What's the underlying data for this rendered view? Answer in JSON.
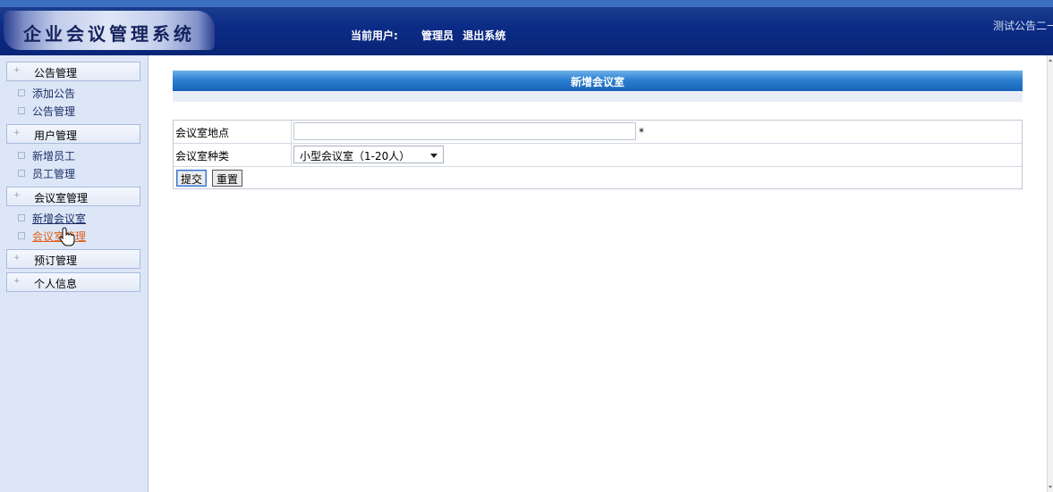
{
  "header": {
    "app_title": "企业会议管理系统",
    "current_user_label": "当前用户:",
    "current_user": "管理员",
    "logout": "退出系统",
    "notice": "测试公告二一"
  },
  "sidebar": {
    "groups": [
      {
        "label": "公告管理",
        "items": [
          "添加公告",
          "公告管理"
        ]
      },
      {
        "label": "用户管理",
        "items": [
          "新增员工",
          "员工管理"
        ]
      },
      {
        "label": "会议室管理",
        "items": [
          "新增会议室",
          "会议室管理"
        ]
      },
      {
        "label": "预订管理",
        "items": []
      },
      {
        "label": "个人信息",
        "items": []
      }
    ]
  },
  "main": {
    "title": "新增会议室",
    "form": {
      "location_label": "会议室地点",
      "location_value": "",
      "required_mark": "*",
      "type_label": "会议室种类",
      "type_selected": "小型会议室（1-20人）",
      "submit": "提交",
      "reset": "重置"
    }
  },
  "colors": {
    "header_bg": "#0b2b86",
    "sidebar_bg": "#dde6f6",
    "title_bar": "#2d7fd1",
    "active_link": "#e0601c"
  }
}
